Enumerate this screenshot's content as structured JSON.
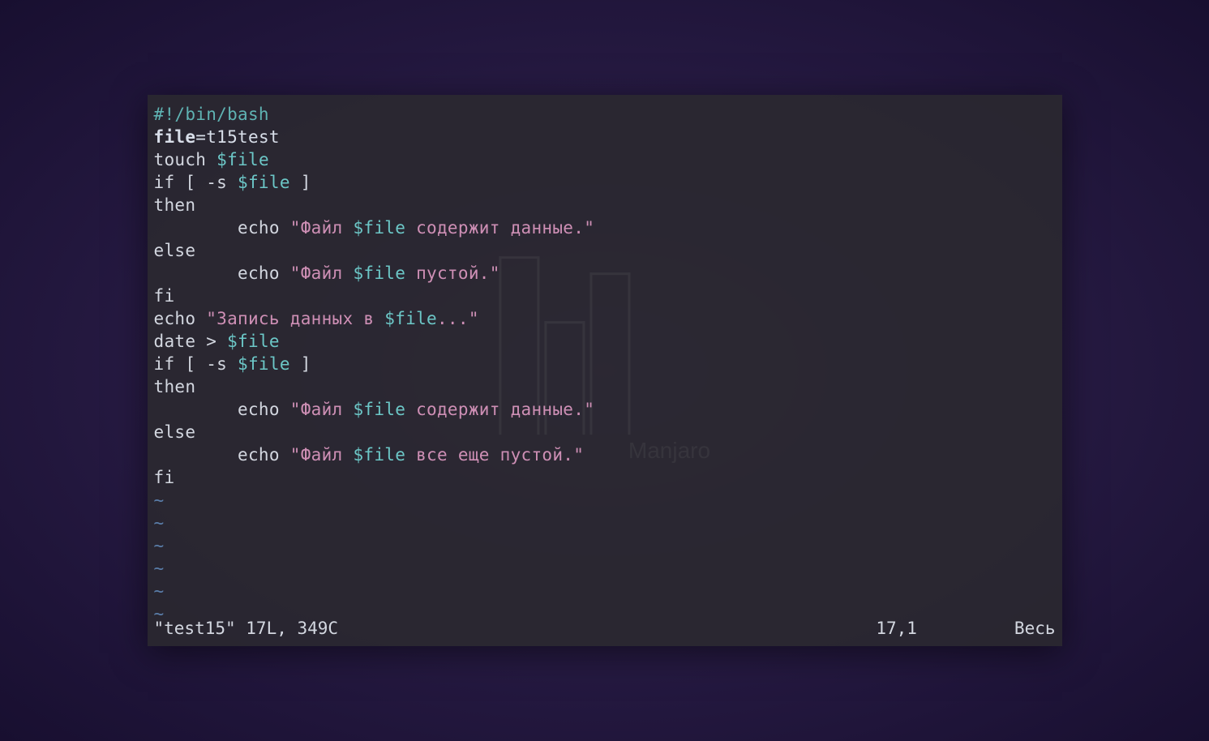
{
  "desktop": {
    "distro_name": "Manjaro"
  },
  "editor": {
    "lines": [
      {
        "segments": [
          {
            "text": "#!/bin/bash",
            "cls": "c-shebang"
          }
        ]
      },
      {
        "segments": [
          {
            "text": "file",
            "cls": "c-keyword"
          },
          {
            "text": "=t15test",
            "cls": "c-assign"
          }
        ]
      },
      {
        "segments": [
          {
            "text": "touch ",
            "cls": "c-text"
          },
          {
            "text": "$file",
            "cls": "c-var"
          }
        ]
      },
      {
        "segments": [
          {
            "text": "if [ -s ",
            "cls": "c-text"
          },
          {
            "text": "$file",
            "cls": "c-var"
          },
          {
            "text": " ]",
            "cls": "c-text"
          }
        ]
      },
      {
        "segments": [
          {
            "text": "then",
            "cls": "c-text"
          }
        ]
      },
      {
        "segments": [
          {
            "text": "        echo ",
            "cls": "c-text"
          },
          {
            "text": "\"Файл ",
            "cls": "c-string"
          },
          {
            "text": "$file",
            "cls": "c-var"
          },
          {
            "text": " содержит данные.\"",
            "cls": "c-string"
          }
        ]
      },
      {
        "segments": [
          {
            "text": "else",
            "cls": "c-text"
          }
        ]
      },
      {
        "segments": [
          {
            "text": "        echo ",
            "cls": "c-text"
          },
          {
            "text": "\"Файл ",
            "cls": "c-string"
          },
          {
            "text": "$file",
            "cls": "c-var"
          },
          {
            "text": " пустой.\"",
            "cls": "c-string"
          }
        ]
      },
      {
        "segments": [
          {
            "text": "fi",
            "cls": "c-text"
          }
        ]
      },
      {
        "segments": [
          {
            "text": "echo ",
            "cls": "c-text"
          },
          {
            "text": "\"Запись данных в ",
            "cls": "c-string"
          },
          {
            "text": "$file",
            "cls": "c-var"
          },
          {
            "text": "...\"",
            "cls": "c-string"
          }
        ]
      },
      {
        "segments": [
          {
            "text": "date > ",
            "cls": "c-text"
          },
          {
            "text": "$file",
            "cls": "c-var"
          }
        ]
      },
      {
        "segments": [
          {
            "text": "if [ -s ",
            "cls": "c-text"
          },
          {
            "text": "$file",
            "cls": "c-var"
          },
          {
            "text": " ]",
            "cls": "c-text"
          }
        ]
      },
      {
        "segments": [
          {
            "text": "then",
            "cls": "c-text"
          }
        ]
      },
      {
        "segments": [
          {
            "text": "        echo ",
            "cls": "c-text"
          },
          {
            "text": "\"Файл ",
            "cls": "c-string"
          },
          {
            "text": "$file",
            "cls": "c-var"
          },
          {
            "text": " содержит данные.\"",
            "cls": "c-string"
          }
        ]
      },
      {
        "segments": [
          {
            "text": "else",
            "cls": "c-text"
          }
        ]
      },
      {
        "segments": [
          {
            "text": "        echo ",
            "cls": "c-text"
          },
          {
            "text": "\"Файл ",
            "cls": "c-string"
          },
          {
            "text": "$file",
            "cls": "c-var"
          },
          {
            "text": " все еще пустой.\"",
            "cls": "c-string"
          }
        ]
      },
      {
        "segments": [
          {
            "text": "fi",
            "cls": "c-text"
          }
        ]
      }
    ],
    "tilde_count": 6,
    "tilde_char": "~",
    "status": {
      "filename": "\"test15\" 17L, 349C",
      "cursor": "17,1",
      "scroll": "Весь"
    }
  }
}
